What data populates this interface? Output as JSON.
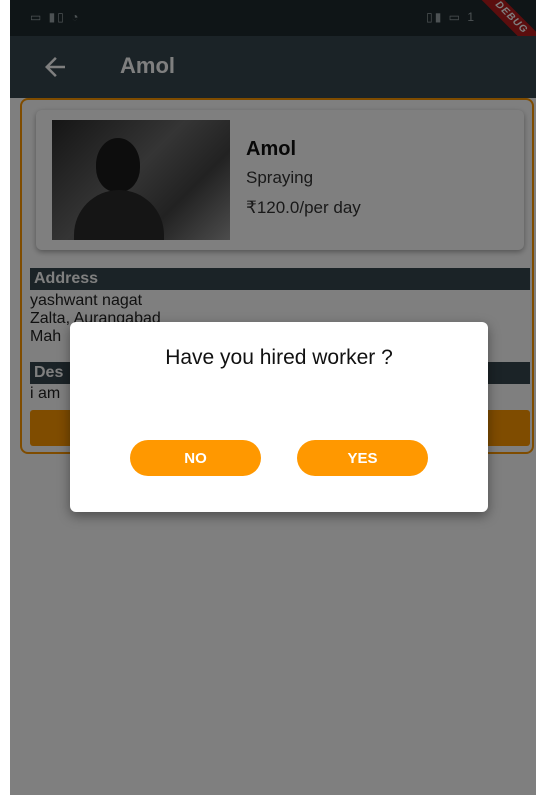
{
  "status_bar": {
    "left_icons": "▭ ▮▯ ◔",
    "right_icons": "▯▮ ▭ 1"
  },
  "debug_banner": "DEBUG",
  "app_bar": {
    "title": "Amol",
    "back_icon": "arrow-left-icon"
  },
  "profile": {
    "name": "Amol",
    "skill": "Spraying",
    "rate": "₹120.0/per day",
    "avatar_icon": "profile-photo"
  },
  "address": {
    "header": "Address",
    "lines": [
      "yashwant nagat",
      " Zalta, Aurangabad",
      "Mah"
    ]
  },
  "description": {
    "header": "Des",
    "text": "i am"
  },
  "dialog": {
    "title": "Have you hired worker ?",
    "no_label": "NO",
    "yes_label": "YES"
  },
  "colors": {
    "accent": "#ff9800",
    "appbar": "#37474f",
    "statusbar": "#1e2a2e"
  }
}
